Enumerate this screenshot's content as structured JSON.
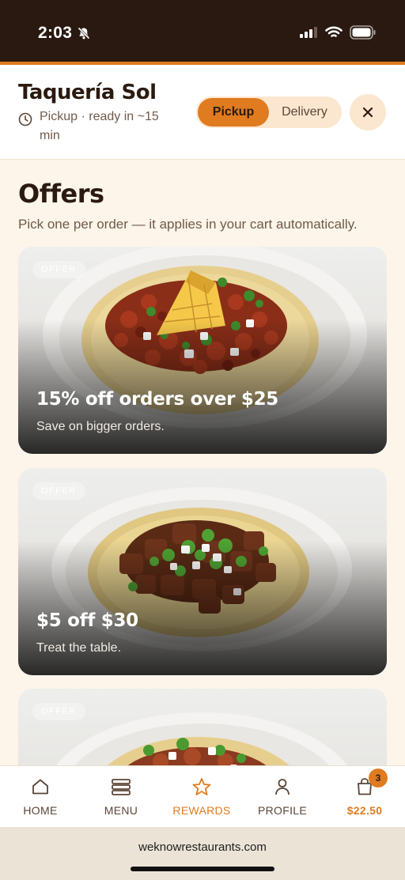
{
  "status_bar": {
    "time": "2:03"
  },
  "header": {
    "restaurant_name": "Taquería Sol",
    "pickup_info": "Pickup · ready in ~15 min",
    "modes": [
      "Pickup",
      "Delivery"
    ],
    "active_mode": "Pickup"
  },
  "page": {
    "title": "Offers",
    "subtitle": "Pick one per order — it applies in your cart automatically."
  },
  "offers": [
    {
      "badge": "OFFER",
      "title": "15% off orders over $25",
      "description": "Save on bigger orders."
    },
    {
      "badge": "OFFER",
      "title": "$5 off $30",
      "description": "Treat the table."
    },
    {
      "badge": "OFFER",
      "title": "",
      "description": ""
    }
  ],
  "bottom_nav": {
    "items": [
      "HOME",
      "MENU",
      "REWARDS",
      "PROFILE",
      "$22.50"
    ],
    "active": "REWARDS",
    "cart_count": "3"
  },
  "browser": {
    "url": "weknowrestaurants.com"
  },
  "colors": {
    "accent": "#e07b1f",
    "dark": "#2b1a10",
    "background": "#fdf5ea",
    "status_bar": "#2a1910"
  }
}
